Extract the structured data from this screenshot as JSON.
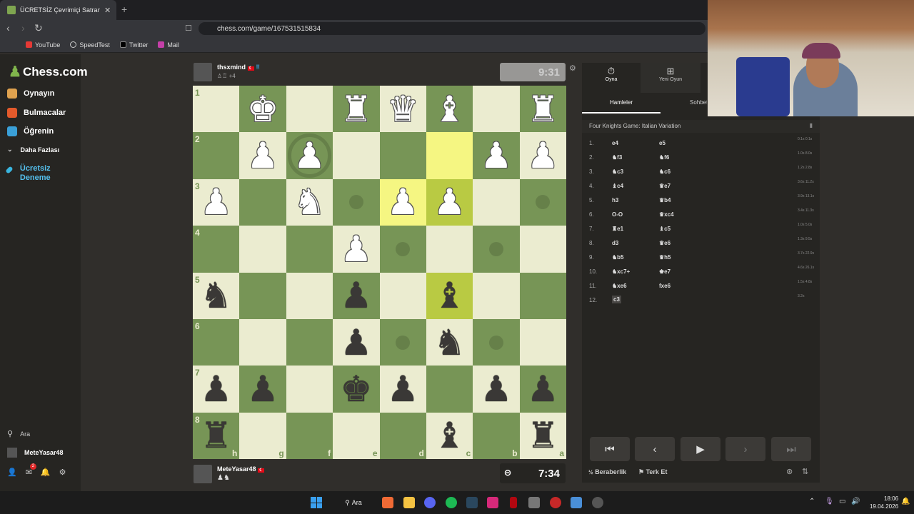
{
  "browser": {
    "tab_title": "ÜCRETSİZ Çevrimiçi Satranç Oyna",
    "url": "chess.com/game/167531515834",
    "bookmarks": [
      "YouTube",
      "SpeedTest",
      "Twitter",
      "Mail"
    ]
  },
  "sidebar": {
    "logo": "Chess.com",
    "items": [
      {
        "label": "Oynayın",
        "color": "#e0a24f"
      },
      {
        "label": "Bulmacalar",
        "color": "#e45a2b"
      },
      {
        "label": "Öğrenin",
        "color": "#3aa0d8"
      },
      {
        "label": "Daha Fazlası",
        "color": ""
      },
      {
        "label": "Ücretsiz Deneme",
        "color": "#39b6e0"
      }
    ],
    "search": "Ara",
    "user": "MeteYasar48",
    "notif_count": "2"
  },
  "top_player": {
    "name": "thsxmind",
    "extra": "+4",
    "clock": "9:31"
  },
  "bottom_player": {
    "name": "MeteYasar48",
    "clock": "7:34"
  },
  "board": {
    "ranks": [
      "1",
      "2",
      "3",
      "4",
      "5",
      "6",
      "7",
      "8"
    ],
    "files": [
      "h",
      "g",
      "f",
      "e",
      "d",
      "c",
      "b",
      "a"
    ],
    "rows": [
      [
        [
          "",
          ""
        ],
        [
          "w",
          "♚"
        ],
        [
          "",
          ""
        ],
        [
          "w",
          "♜"
        ],
        [
          "w",
          "♛"
        ],
        [
          "w",
          "♝"
        ],
        [
          "",
          ""
        ],
        [
          "w",
          "♜"
        ]
      ],
      [
        [
          "",
          ""
        ],
        [
          "w",
          "♟"
        ],
        [
          "w",
          "♟"
        ],
        [
          "",
          ""
        ],
        [
          "",
          ""
        ],
        [
          "",
          ""
        ],
        [
          "w",
          "♟"
        ],
        [
          "w",
          "♟"
        ]
      ],
      [
        [
          "w",
          "♟"
        ],
        [
          "",
          ""
        ],
        [
          "w",
          "♞"
        ],
        [
          "",
          ""
        ],
        [
          "w",
          "♟"
        ],
        [
          "w",
          "♟"
        ],
        [
          "",
          ""
        ],
        [
          "",
          ""
        ]
      ],
      [
        [
          "",
          ""
        ],
        [
          "",
          ""
        ],
        [
          "",
          ""
        ],
        [
          "w",
          "♟"
        ],
        [
          "",
          ""
        ],
        [
          "",
          ""
        ],
        [
          "",
          ""
        ],
        [
          "",
          ""
        ]
      ],
      [
        [
          "b",
          "♞"
        ],
        [
          "",
          ""
        ],
        [
          "",
          ""
        ],
        [
          "b",
          "♟"
        ],
        [
          "",
          ""
        ],
        [
          "b",
          "♝"
        ],
        [
          "",
          ""
        ],
        [
          "",
          ""
        ]
      ],
      [
        [
          "",
          ""
        ],
        [
          "",
          ""
        ],
        [
          "",
          ""
        ],
        [
          "b",
          "♟"
        ],
        [
          "",
          ""
        ],
        [
          "b",
          "♞"
        ],
        [
          "",
          ""
        ],
        [
          "",
          ""
        ]
      ],
      [
        [
          "b",
          "♟"
        ],
        [
          "b",
          "♟"
        ],
        [
          "",
          ""
        ],
        [
          "b",
          "♚"
        ],
        [
          "b",
          "♟"
        ],
        [
          "",
          ""
        ],
        [
          "b",
          "♟"
        ],
        [
          "b",
          "♟"
        ]
      ],
      [
        [
          "b",
          "♜"
        ],
        [
          "",
          ""
        ],
        [
          "",
          ""
        ],
        [
          "",
          ""
        ],
        [
          "",
          ""
        ],
        [
          "b",
          "♝"
        ],
        [
          "",
          ""
        ],
        [
          "b",
          "♜"
        ]
      ]
    ]
  },
  "panel": {
    "tabs": [
      "Oyna",
      "Yeni Oyun"
    ],
    "subtabs": [
      "Hamleler",
      "Sohbet"
    ],
    "opening": "Four Knights Game: Italian Variation",
    "moves": [
      {
        "n": "1.",
        "w": "e4",
        "b": "e5",
        "t": "0.1s 0.1s"
      },
      {
        "n": "2.",
        "w": "♞f3",
        "b": "♞f6",
        "t": "1.0s 8.0s"
      },
      {
        "n": "3.",
        "w": "♞c3",
        "b": "♞c6",
        "t": "1.2s 2.8s"
      },
      {
        "n": "4.",
        "w": "♝c4",
        "b": "♛e7",
        "t": "3.6s 11.2s"
      },
      {
        "n": "5.",
        "w": "h3",
        "b": "♛b4",
        "t": "3.9s 13.1s"
      },
      {
        "n": "6.",
        "w": "O-O",
        "b": "♛xc4",
        "t": "3.4s 11.3s"
      },
      {
        "n": "7.",
        "w": "♜e1",
        "b": "♝c5",
        "t": "1.0s 5.0s"
      },
      {
        "n": "8.",
        "w": "d3",
        "b": "♛e6",
        "t": "1.3s 9.5s"
      },
      {
        "n": "9.",
        "w": "♞b5",
        "b": "♛h5",
        "t": "3.7s 22.9s"
      },
      {
        "n": "10.",
        "w": "♞xc7+",
        "b": "♚e7",
        "t": "4.6s 26.1s"
      },
      {
        "n": "11.",
        "w": "♞xe6",
        "b": "fxe6",
        "t": "1.5s 4.8s"
      },
      {
        "n": "12.",
        "w": "c3",
        "b": "",
        "t": "3.2s"
      }
    ],
    "draw": "Beraberlik",
    "resign": "Terk Et"
  },
  "taskbar": {
    "search": "Ara",
    "time": "18:06",
    "date": "19.04.2026"
  }
}
